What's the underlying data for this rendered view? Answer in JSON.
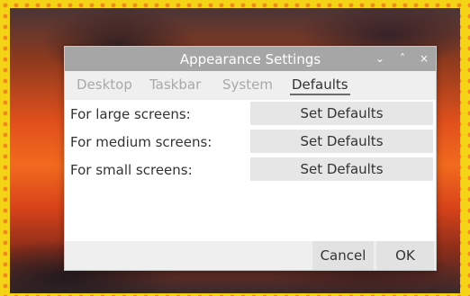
{
  "window": {
    "title": "Appearance Settings",
    "controls": {
      "minimize": "⌄",
      "maximize": "˄",
      "close": "×"
    }
  },
  "tabs": [
    {
      "label": "Desktop"
    },
    {
      "label": "Taskbar"
    },
    {
      "label": "System"
    },
    {
      "label": "Defaults"
    }
  ],
  "rows": [
    {
      "label": "For large screens:",
      "button": "Set Defaults"
    },
    {
      "label": "For medium screens:",
      "button": "Set Defaults"
    },
    {
      "label": "For small screens:",
      "button": "Set Defaults"
    }
  ],
  "footer": {
    "cancel_label": "Cancel",
    "ok_label": "OK"
  }
}
